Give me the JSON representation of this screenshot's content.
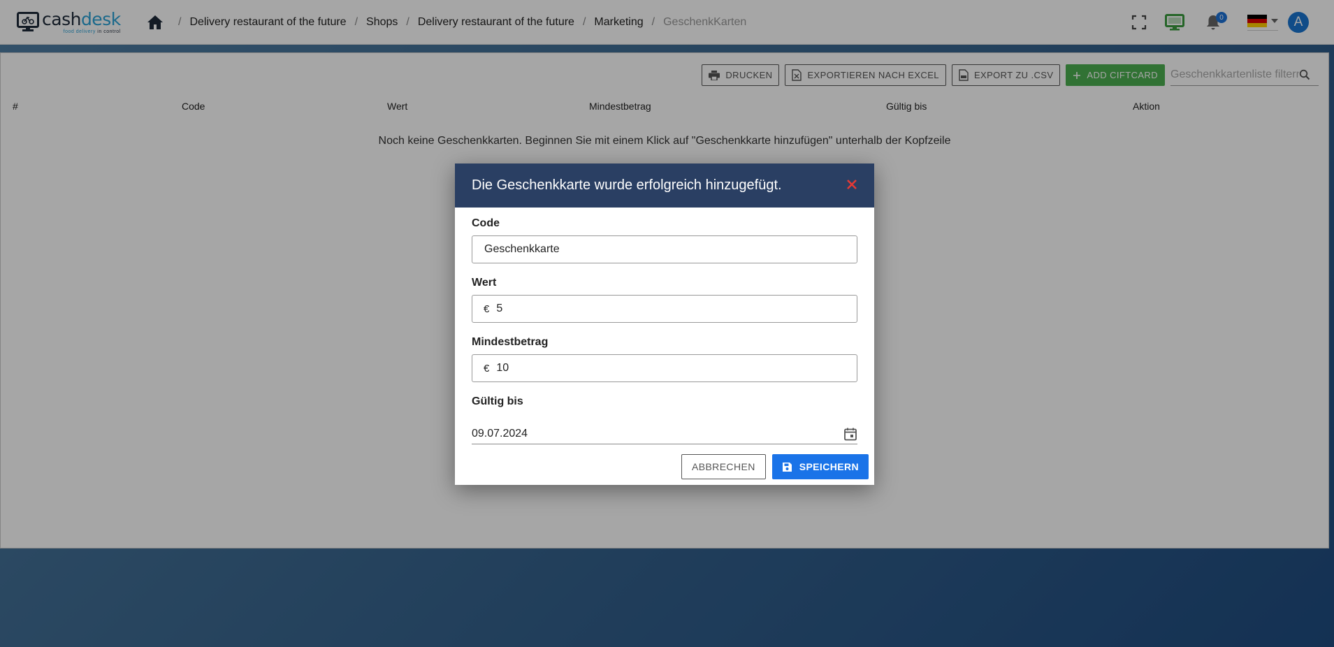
{
  "brand": {
    "name_part1": "cash",
    "name_part2": "desk",
    "tagline_part1": "food delivery ",
    "tagline_part2": "in control"
  },
  "breadcrumb": [
    "Delivery restaurant of the future",
    "Shops",
    "Delivery restaurant of the future",
    "Marketing",
    "GeschenkKarten"
  ],
  "header": {
    "notification_count": "0",
    "avatar_letter": "A",
    "language": "de"
  },
  "toolbar": {
    "print": "DRUCKEN",
    "excel": "EXPORTIEREN NACH EXCEL",
    "csv": "EXPORT ZU .CSV",
    "add": "ADD CIFTCARD",
    "filter_placeholder": "Geschenkkartenliste filtern"
  },
  "table": {
    "columns": [
      "#",
      "Code",
      "Wert",
      "Mindestbetrag",
      "Gültig bis",
      "Aktion"
    ],
    "empty_message": "Noch keine Geschenkkarten. Beginnen Sie mit einem Klick auf \"Geschenkkarte hinzufügen\" unterhalb der Kopfzeile"
  },
  "dialog": {
    "title": "Die Geschenkkarte wurde erfolgreich hinzugefügt.",
    "code_label": "Code",
    "code_value": "Geschenkkarte",
    "wert_label": "Wert",
    "currency": "€",
    "wert_value": "5",
    "min_label": "Mindestbetrag",
    "min_value": "10",
    "valid_label": "Gültig bis",
    "valid_value": "09.07.2024",
    "cancel": "ABBRECHEN",
    "save": "SPEICHERN"
  },
  "colors": {
    "dialog_header": "#2a3f63",
    "primary": "#1a73e8",
    "success": "#4caf50",
    "close": "#e53935"
  }
}
